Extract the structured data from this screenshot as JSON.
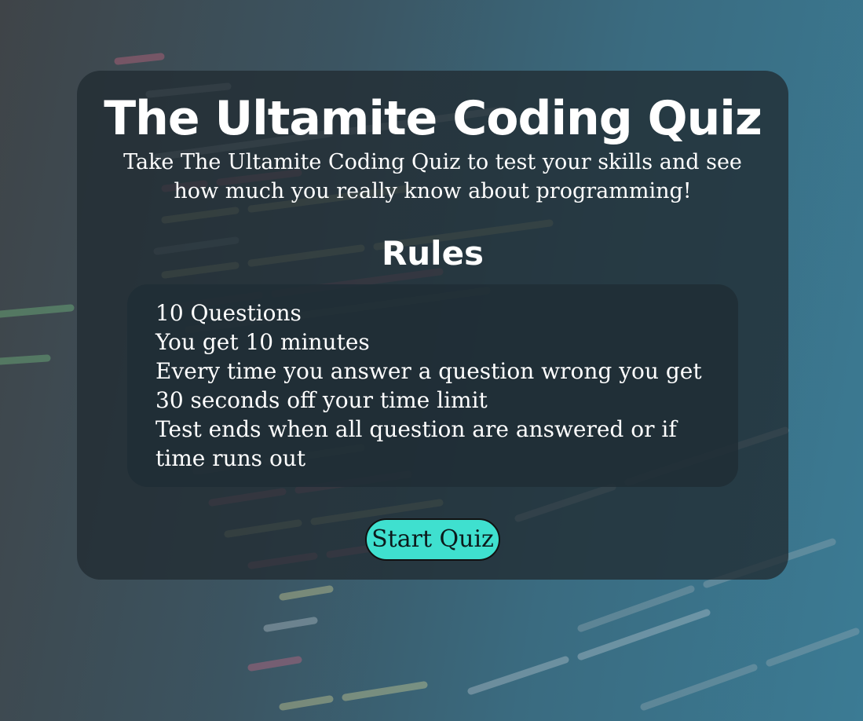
{
  "quiz": {
    "title": "The Ultamite Coding Quiz",
    "subtitle": "Take The Ultamite Coding Quiz to test your skills and see how much you really know about programming!",
    "rules_heading": "Rules",
    "rules": [
      "10 Questions",
      "You get 10 minutes",
      "Every time you answer a question wrong you get 30 seconds off your time limit",
      "Test ends when all question are answered or if time runs out"
    ],
    "start_button_label": "Start Quiz"
  },
  "colors": {
    "button_fill": "#3fe0cf",
    "card_background": "#212c32",
    "text": "#ffffff"
  }
}
